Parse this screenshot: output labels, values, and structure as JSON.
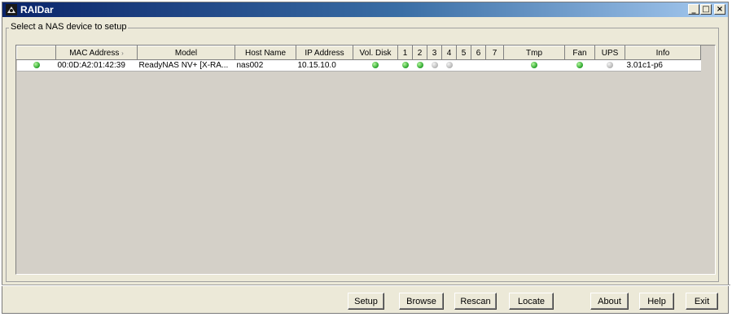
{
  "window": {
    "title": "RAIDar",
    "controls": [
      "minimize",
      "maximize",
      "close"
    ]
  },
  "group": {
    "label": "Select a NAS device to setup"
  },
  "table": {
    "columns": [
      "",
      "MAC Address",
      "Model",
      "Host Name",
      "IP Address",
      "Vol. Disk",
      "1",
      "2",
      "3",
      "4",
      "5",
      "6",
      "7",
      "Tmp",
      "Fan",
      "UPS",
      "Info"
    ],
    "sort_indicator": "›",
    "rows": [
      {
        "status": "green",
        "mac": "00:0D:A2:01:42:39",
        "model": "ReadyNAS NV+ [X-RA...",
        "host": "nas002",
        "ip": "10.15.10.0",
        "vol": "green",
        "disks": [
          "green",
          "green",
          "gray",
          "gray",
          "",
          "",
          ""
        ],
        "tmp": "green",
        "fan": "green",
        "ups": "gray",
        "info": "3.01c1-p6"
      }
    ]
  },
  "buttons": {
    "setup": "Setup",
    "browse": "Browse",
    "rescan": "Rescan",
    "locate": "Locate",
    "about": "About",
    "help": "Help",
    "exit": "Exit"
  },
  "icons": {
    "app": "raidar-app-icon",
    "status_ok": "#2fa82f",
    "status_off": "#b9b9b9"
  }
}
